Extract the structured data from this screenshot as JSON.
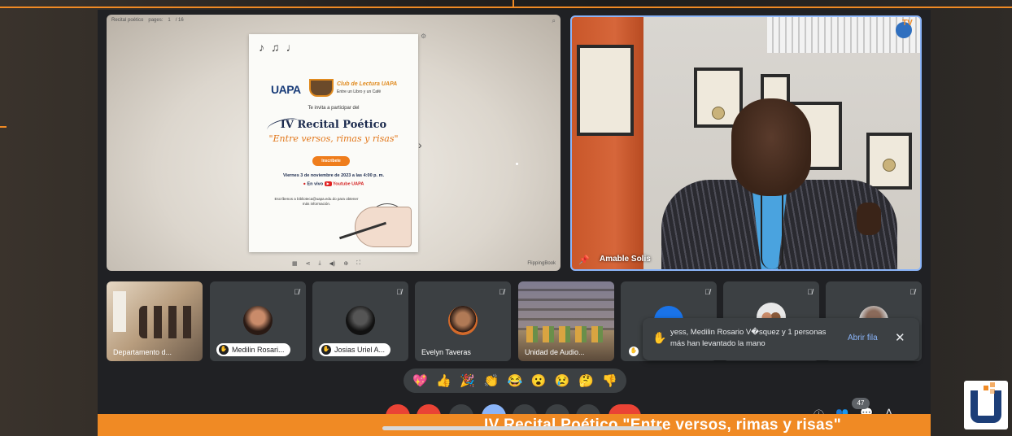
{
  "presentation": {
    "toolbar_title": "Recital poético",
    "toolbar_pages_label": "pages:",
    "toolbar_page_current": "1",
    "toolbar_page_total": "/ 16",
    "brand": "FlippingBook",
    "flyer": {
      "org": "UAPA",
      "club_title": "Club de Lectura UAPA",
      "club_subtitle": "Entre un Libro y un Café",
      "invite": "Te invita a participar del",
      "title": "IV Recital Poético",
      "subtitle": "\"Entre versos, rimas y risas\"",
      "button": "Inscríbete",
      "date": "Viernes 3 de noviembre de 2023 a las 4:00 p. m.",
      "live_prefix": "En vivo",
      "live_channel": "Youtube UAPA",
      "contact": "Escríbenos a biblioteca@uapa.edu.do para obtener más información."
    }
  },
  "speaker": {
    "name": "Amable Solis"
  },
  "participants": [
    {
      "name": "Departamento d...",
      "mode": "video"
    },
    {
      "name": "Medilin Rosari...",
      "mode": "avatar",
      "hand_raised": true
    },
    {
      "name": "Josias Uriel A...",
      "mode": "avatar",
      "hand_raised": true
    },
    {
      "name": "Evelyn Taveras",
      "mode": "avatar"
    },
    {
      "name": "Unidad de Audio...",
      "mode": "video"
    },
    {
      "name": "",
      "mode": "avatar",
      "hand_raised": true
    },
    {
      "name": "",
      "mode": "avatar"
    },
    {
      "name": "",
      "mode": "avatar"
    }
  ],
  "notification": {
    "message": "yess, Medilin Rosario V�squez y 1 personas más han levantado la mano",
    "action": "Abrir fila"
  },
  "reactions": [
    "💖",
    "👍",
    "🎉",
    "👏",
    "😂",
    "😮",
    "😢",
    "🤔",
    "👎"
  ],
  "participant_count": "47",
  "banner": {
    "text": "IV Recital Poético \"Entre versos, rimas y risas\""
  },
  "colors": {
    "brand_orange": "#f08a24",
    "brand_blue": "#1c3e78",
    "meet_bg": "#202124",
    "tile_bg": "#3c4043",
    "accent_blue": "#8ab4f8",
    "danger_red": "#ea4335"
  }
}
